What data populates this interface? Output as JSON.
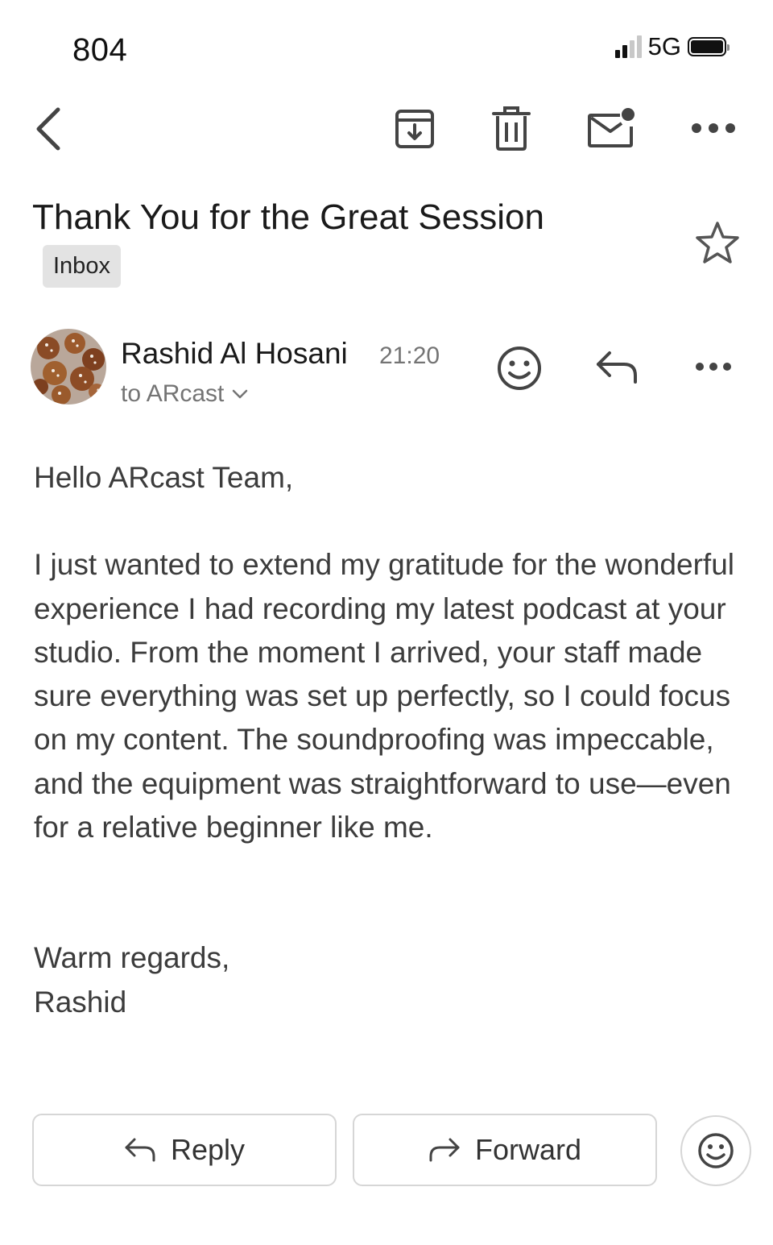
{
  "status_bar": {
    "time": "804",
    "network": "5G",
    "signal_bars_active": 2,
    "signal_bars_total": 4
  },
  "toolbar": {
    "back_icon": "chevron-left-icon",
    "archive_icon": "archive-icon",
    "delete_icon": "trash-icon",
    "mark_unread_icon": "mail-unread-icon",
    "more_icon": "more-horizontal-icon"
  },
  "email": {
    "subject": "Thank You for the Great Session",
    "label": "Inbox",
    "starred": false,
    "sender_name": "Rashid Al Hosani",
    "time": "21:20",
    "recipient": "to ARcast",
    "greeting": "Hello ARcast Team,",
    "body": "I just wanted to extend my gratitude for the wonderful experience I had recording my latest podcast at your studio. From the moment I arrived, your staff made sure everything was set up perfectly, so I could focus on my content. The soundproofing was impeccable, and the equipment was straightforward to use—even for a relative beginner like me.",
    "signoff": "Warm regards,",
    "signature": "Rashid"
  },
  "actions": {
    "reply_label": "Reply",
    "forward_label": "Forward"
  },
  "colors": {
    "text_primary": "#1a1a1a",
    "text_secondary": "#747474",
    "chip_bg": "#e3e3e3",
    "border": "#d6d6d6"
  }
}
